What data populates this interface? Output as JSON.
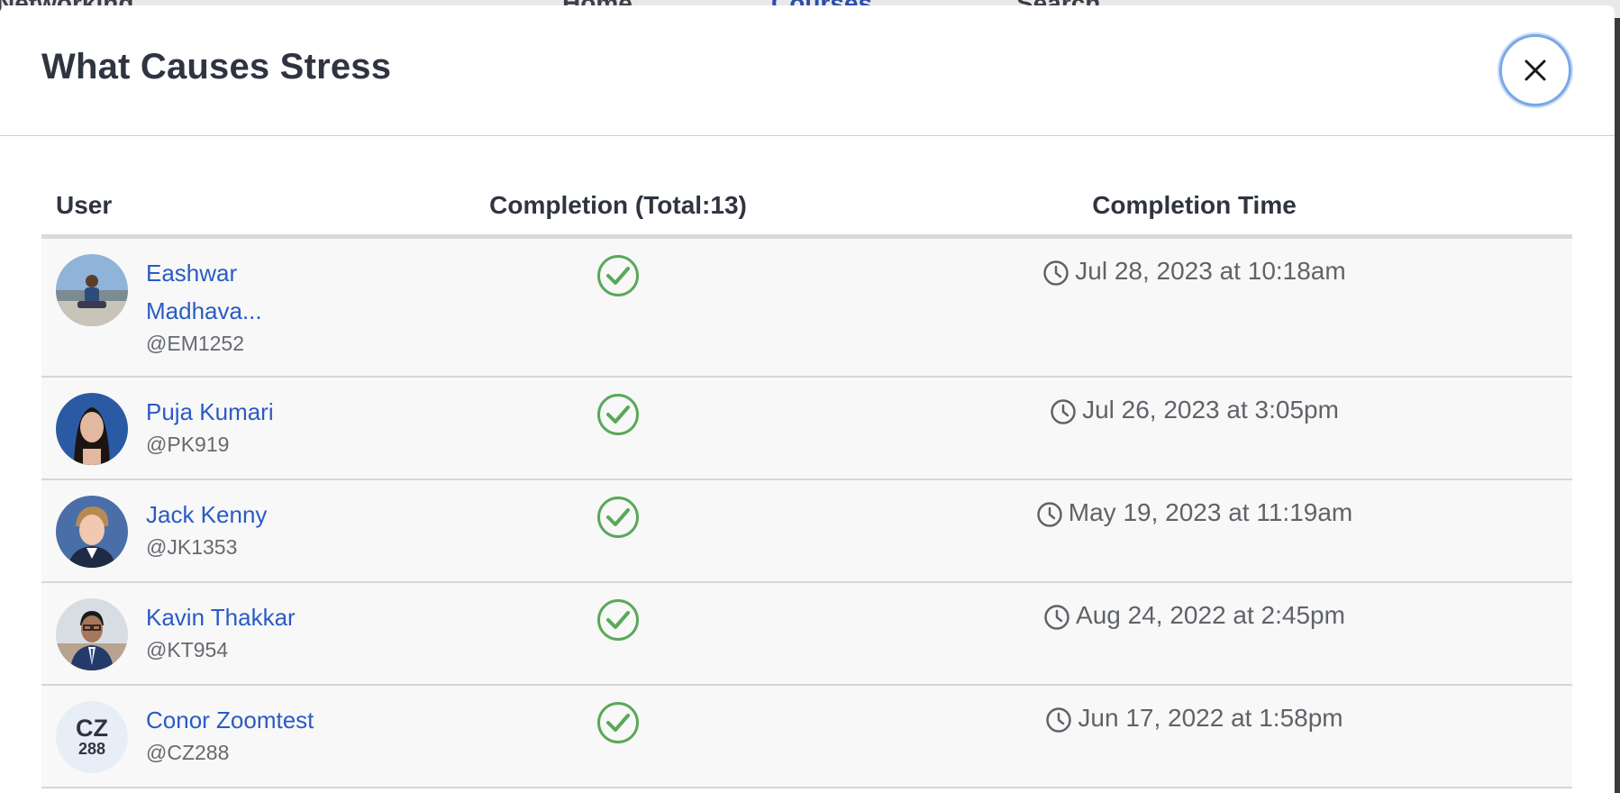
{
  "background_nav": {
    "brand": "Networking",
    "home": "Home",
    "courses": "Courses",
    "search": "Search"
  },
  "modal": {
    "title": "What Causes Stress",
    "close_icon": "close-icon"
  },
  "table": {
    "headers": {
      "user": "User",
      "completion": "Completion (Total:13)",
      "time": "Completion Time"
    },
    "rows": [
      {
        "name_line1": "Eashwar",
        "name_line2": "Madhava...",
        "handle": "@EM1252",
        "completed": true,
        "time": "Jul 28, 2023 at 10:18am",
        "avatar": "photo-avatar"
      },
      {
        "name_line1": "Puja Kumari",
        "name_line2": "",
        "handle": "@PK919",
        "completed": true,
        "time": "Jul 26, 2023 at 3:05pm",
        "avatar": "photo-avatar"
      },
      {
        "name_line1": "Jack Kenny",
        "name_line2": "",
        "handle": "@JK1353",
        "completed": true,
        "time": "May 19, 2023 at 11:19am",
        "avatar": "photo-avatar"
      },
      {
        "name_line1": "Kavin Thakkar",
        "name_line2": "",
        "handle": "@KT954",
        "completed": true,
        "time": "Aug 24, 2022 at 2:45pm",
        "avatar": "photo-avatar"
      },
      {
        "name_line1": "Conor Zoomtest",
        "name_line2": "",
        "handle": "@CZ288",
        "completed": true,
        "time": "Jun 17, 2022 at 1:58pm",
        "avatar": "initials-avatar",
        "initials_top": "CZ",
        "initials_bottom": "288"
      }
    ]
  },
  "colors": {
    "link": "#2a5bc4",
    "check": "#5aa85a",
    "title": "#2f3440",
    "close_ring": "#7aa7e6"
  }
}
